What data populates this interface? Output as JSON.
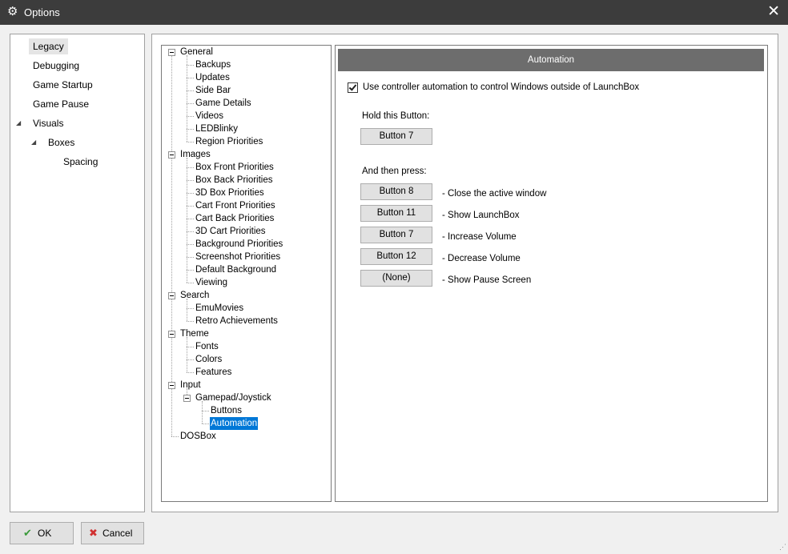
{
  "window": {
    "title": "Options",
    "icon": "gear-icon",
    "close_icon": "close-icon"
  },
  "category_nav": [
    {
      "label": "Legacy",
      "selected": true
    },
    {
      "label": "Debugging"
    },
    {
      "label": "Game Startup"
    },
    {
      "label": "Game Pause"
    },
    {
      "label": "Visuals",
      "expanded": true
    },
    {
      "label": "Boxes",
      "expanded": true
    },
    {
      "label": "Spacing"
    }
  ],
  "tree": [
    {
      "label": "General"
    },
    {
      "label": "Backups"
    },
    {
      "label": "Updates"
    },
    {
      "label": "Side Bar"
    },
    {
      "label": "Game Details"
    },
    {
      "label": "Videos"
    },
    {
      "label": "LEDBlinky"
    },
    {
      "label": "Region Priorities"
    },
    {
      "label": "Images"
    },
    {
      "label": "Box Front Priorities"
    },
    {
      "label": "Box Back Priorities"
    },
    {
      "label": "3D Box Priorities"
    },
    {
      "label": "Cart Front Priorities"
    },
    {
      "label": "Cart Back Priorities"
    },
    {
      "label": "3D Cart Priorities"
    },
    {
      "label": "Background Priorities"
    },
    {
      "label": "Screenshot Priorities"
    },
    {
      "label": "Default Background"
    },
    {
      "label": "Viewing"
    },
    {
      "label": "Search"
    },
    {
      "label": "EmuMovies"
    },
    {
      "label": "Retro Achievements"
    },
    {
      "label": "Theme"
    },
    {
      "label": "Fonts"
    },
    {
      "label": "Colors"
    },
    {
      "label": "Features"
    },
    {
      "label": "Input"
    },
    {
      "label": "Gamepad/Joystick"
    },
    {
      "label": "Buttons"
    },
    {
      "label": "Automation",
      "selected": true
    },
    {
      "label": "DOSBox"
    }
  ],
  "automation": {
    "header": "Automation",
    "enable_checkbox": {
      "label": "Use controller automation to control Windows outside of LaunchBox",
      "checked": true
    },
    "hold_label": "Hold this Button:",
    "hold_button": "Button 7",
    "then_label": "And then press:",
    "actions": [
      {
        "button": "Button 8",
        "action": "-  Close the active window"
      },
      {
        "button": "Button 11",
        "action": "-  Show LaunchBox"
      },
      {
        "button": "Button 7",
        "action": "-  Increase Volume"
      },
      {
        "button": "Button 12",
        "action": "-  Decrease Volume"
      },
      {
        "button": "(None)",
        "action": "-  Show Pause Screen"
      }
    ]
  },
  "footer": {
    "ok_label": "OK",
    "ok_icon": "checkmark-icon",
    "cancel_label": "Cancel",
    "cancel_icon": "x-icon"
  },
  "colors": {
    "selection": "#0078d7",
    "header_bar": "#6d6d6d",
    "titlebar": "#3c3c3c",
    "ok_icon": "#3a9a3a",
    "cancel_icon": "#d03030"
  }
}
